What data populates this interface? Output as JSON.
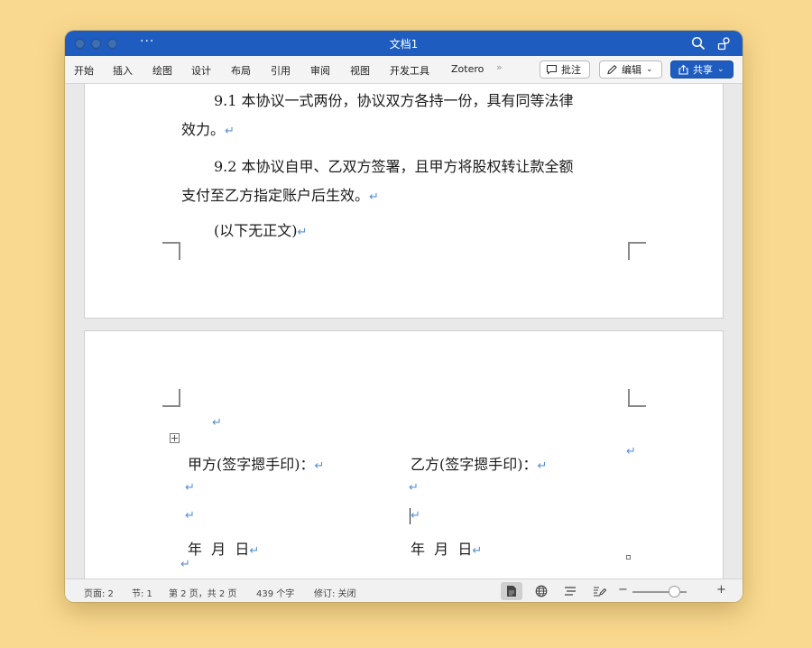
{
  "window": {
    "title": "文档1"
  },
  "ribbon": {
    "tabs": [
      "开始",
      "插入",
      "绘图",
      "设计",
      "布局",
      "引用",
      "审阅",
      "视图",
      "开发工具",
      "Zotero"
    ],
    "overflow": "»",
    "comment_label": "批注",
    "edit_label": "编辑",
    "share_label": "共享"
  },
  "document": {
    "page1": {
      "p1_line1": "9.1 本协议一式两份，协议双方各持一份，具有同等法律",
      "p1_line2": "效力。",
      "p2_line1": "9.2 本协议自甲、乙双方签署，且甲方将股权转让款全额",
      "p2_line2": "支付至乙方指定账户后生效。",
      "p3": "(以下无正文)"
    },
    "page2": {
      "party_a": "甲方(签字摁手印)：",
      "party_b": "乙方(签字摁手印)：",
      "date_a": "年  月  日",
      "date_b": "年  月  日"
    },
    "paragraph_mark": "↵"
  },
  "status": {
    "page": "页面: 2",
    "section": "节: 1",
    "page_of": "第 2 页，共 2 页",
    "words": "439 个字",
    "track": "修订: 关闭"
  },
  "zoom": {
    "minus": "−",
    "plus": "+",
    "level": 0.67
  },
  "colors": {
    "titlebar": "#1e5dbf",
    "background": "#f9d98f",
    "paragraph_mark": "#5b8fd6"
  }
}
